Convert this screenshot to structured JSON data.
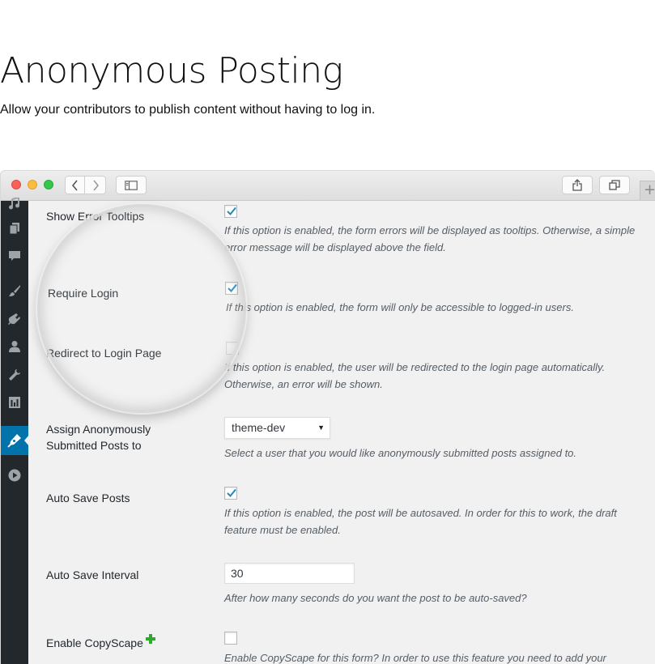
{
  "hero": {
    "title": "Anonymous Posting",
    "subtitle": "Allow your contributors to publish content without having to log in."
  },
  "browser": {
    "traffic_lights": [
      "close",
      "minimize",
      "zoom"
    ],
    "toolbar_icons": [
      "chevron-left-icon",
      "chevron-right-icon",
      "sidebar-icon",
      "share-icon",
      "tabs-icon",
      "plus-icon"
    ]
  },
  "sidebar": {
    "icons": [
      "media-icon",
      "pages-icon",
      "comments-icon",
      "appearance-icon",
      "plugins-icon",
      "users-icon",
      "tools-icon",
      "settings-icon",
      "pen-icon",
      "play-icon"
    ],
    "active": "pen-icon",
    "active_color": "#0073aa"
  },
  "settings": {
    "show_error_tooltips": {
      "label": "Show Error Tooltips",
      "checked": true,
      "description": "If this option is enabled, the form errors will be displayed as tooltips. Otherwise, a simple error message will be displayed above the field."
    },
    "require_login": {
      "label": "Require Login",
      "checked": true,
      "description": "If this option is enabled, the form will only be accessible to logged-in users."
    },
    "redirect_to_login": {
      "label": "Redirect to Login Page",
      "checked": false,
      "description": "If this option is enabled, the user will be redirected to the login page automatically. Otherwise, an error will be shown."
    },
    "assign_user": {
      "label_line1": "Assign Anonymously",
      "label_line2": "Submitted Posts to",
      "selected": "theme-dev",
      "description": "Select a user that you would like anonymously submitted posts assigned to."
    },
    "auto_save": {
      "label": "Auto Save Posts",
      "checked": true,
      "description": "If this option is enabled, the post will be autosaved. In order for this to work, the draft feature must be enabled."
    },
    "auto_save_interval": {
      "label": "Auto Save Interval",
      "value": "30",
      "description": "After how many seconds do you want the post to be auto-saved?"
    },
    "copyscape": {
      "label": "Enable CopyScape",
      "checked": false,
      "description": "Enable CopyScape for this form? In order to use this feature you need to add your"
    }
  },
  "colors": {
    "sidebar_bg": "#23282d",
    "accent": "#0073aa",
    "checkmark": "#1e8cbe",
    "plus": "#2ea82e"
  }
}
